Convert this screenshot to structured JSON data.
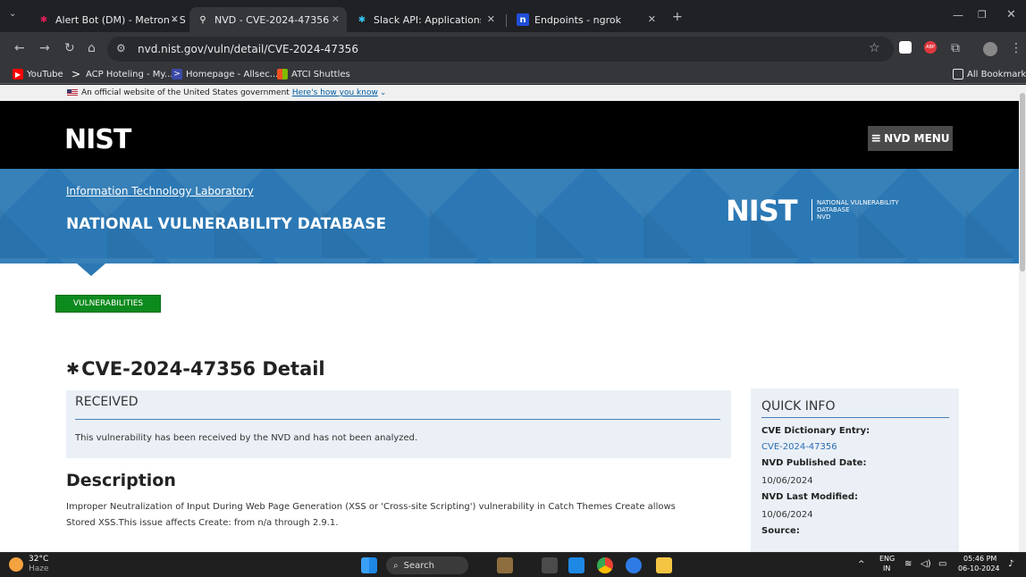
{
  "browser": {
    "tabs": [
      {
        "title": "Alert Bot (DM) - Metron - Slack",
        "icon": "slack-icon",
        "active": false
      },
      {
        "title": "NVD - CVE-2024-47356",
        "icon": "nvd-icon",
        "active": true
      },
      {
        "title": "Slack API: Applications | Metron",
        "icon": "slack-icon",
        "active": false
      },
      {
        "title": "Endpoints - ngrok",
        "icon": "ngrok-icon",
        "active": false
      }
    ],
    "url": "nvd.nist.gov/vuln/detail/CVE-2024-47356",
    "bookmarks": [
      {
        "label": "YouTube",
        "icon": "youtube-icon"
      },
      {
        "label": "ACP Hoteling - My...",
        "icon": "acp-icon"
      },
      {
        "label": "Homepage - Allsec...",
        "icon": "allsec-icon"
      },
      {
        "label": "ATCI Shuttles",
        "icon": "microsoft-icon"
      }
    ],
    "all_bookmarks": "All Bookmarks"
  },
  "page": {
    "gov_banner": {
      "text": "An official website of the United States government",
      "link": "Here's how you know"
    },
    "header": {
      "logo": "NIST",
      "menu_label": "NVD MENU"
    },
    "blue_header": {
      "itl_link": "Information Technology Laboratory",
      "title": "NATIONAL VULNERABILITY DATABASE",
      "logo": "NIST",
      "logo_text": [
        "NATIONAL VULNERABILITY",
        "DATABASE",
        "NVD"
      ]
    },
    "vuln_button": "VULNERABILITIES",
    "cve_title": "CVE-2024-47356 Detail",
    "received": {
      "heading": "RECEIVED",
      "text": "This vulnerability has been received by the NVD and has not been analyzed."
    },
    "description": {
      "heading": "Description",
      "line1": "Improper Neutralization of Input During Web Page Generation (XSS or 'Cross-site Scripting') vulnerability in Catch Themes Create allows",
      "line2": "Stored XSS.This issue affects Create: from n/a through 2.9.1."
    },
    "quick_info": {
      "heading": "QUICK INFO",
      "cve_label": "CVE Dictionary Entry:",
      "cve_value": "CVE-2024-47356",
      "published_label": "NVD Published Date:",
      "published_value": "10/06/2024",
      "modified_label": "NVD Last Modified:",
      "modified_value": "10/06/2024",
      "source_label": "Source:"
    }
  },
  "taskbar": {
    "weather_temp": "32°C",
    "weather_desc": "Haze",
    "search": "Search",
    "lang1": "ENG",
    "lang2": "IN",
    "time": "05:46 PM",
    "date": "06-10-2024"
  },
  "colors": {
    "nvd_blue": "#2b78b4",
    "vuln_green": "#0d8a1e",
    "link": "#2b6cb0"
  }
}
